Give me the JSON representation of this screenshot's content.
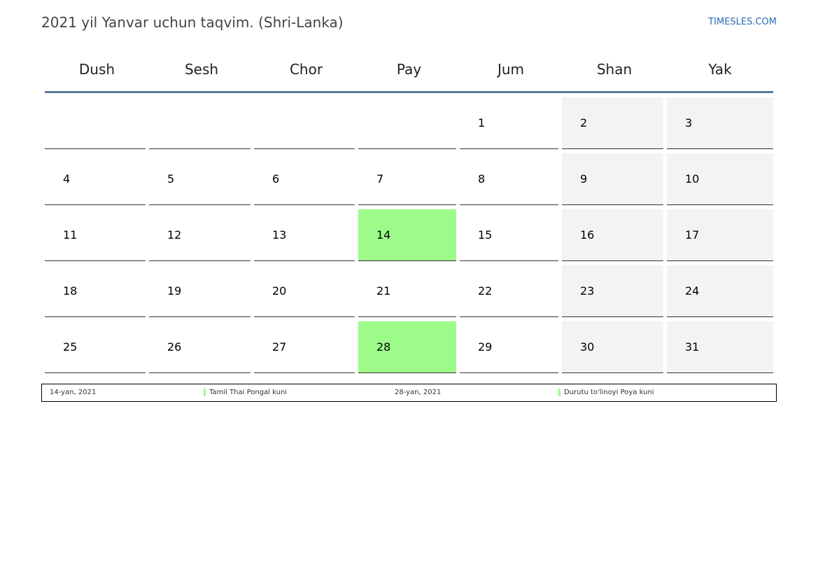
{
  "header": {
    "title": "2021 yil Yanvar uchun taqvim. (Shri-Lanka)",
    "site": "TIMESLES.COM"
  },
  "colors": {
    "holiday": "#9dfb8a",
    "weekend": "#f3f3f3",
    "header_rule": "#5d7a9b",
    "link": "#2a6db5"
  },
  "weekdays": [
    "Dush",
    "Sesh",
    "Chor",
    "Pay",
    "Jum",
    "Shan",
    "Yak"
  ],
  "weeks": [
    [
      "",
      "",
      "",
      "",
      "1",
      "2",
      "3"
    ],
    [
      "4",
      "5",
      "6",
      "7",
      "8",
      "9",
      "10"
    ],
    [
      "11",
      "12",
      "13",
      "14",
      "15",
      "16",
      "17"
    ],
    [
      "18",
      "19",
      "20",
      "21",
      "22",
      "23",
      "24"
    ],
    [
      "25",
      "26",
      "27",
      "28",
      "29",
      "30",
      "31"
    ]
  ],
  "holidays": [
    "14",
    "28"
  ],
  "legend": [
    {
      "date": "14-yan, 2021",
      "name": "Tamil Thai Pongal kuni"
    },
    {
      "date": "28-yan, 2021",
      "name": "Durutu to'linoyi Poya kuni"
    }
  ]
}
